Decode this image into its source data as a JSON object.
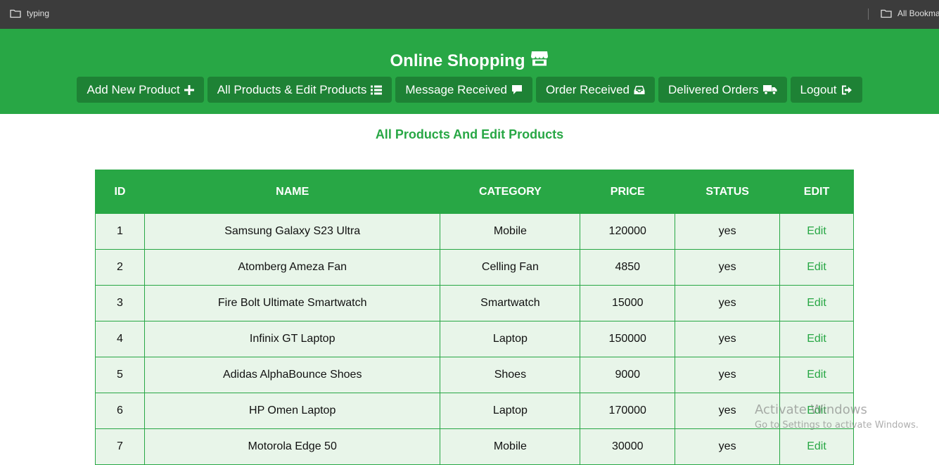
{
  "bookmarks": {
    "left_label": "typing",
    "right_label": "All Bookma"
  },
  "header": {
    "title": "Online Shopping",
    "nav": [
      {
        "label": "Add New Product",
        "icon": "plus-icon"
      },
      {
        "label": "All Products & Edit Products",
        "icon": "list-icon"
      },
      {
        "label": "Message Received",
        "icon": "comment-icon"
      },
      {
        "label": "Order Received",
        "icon": "inbox-icon"
      },
      {
        "label": "Delivered Orders",
        "icon": "truck-icon"
      },
      {
        "label": "Logout",
        "icon": "sign-out-icon"
      }
    ]
  },
  "main": {
    "section_title": "All Products And Edit Products",
    "table": {
      "headers": [
        "ID",
        "NAME",
        "CATEGORY",
        "PRICE",
        "STATUS",
        "EDIT"
      ],
      "rows": [
        {
          "id": "1",
          "name": "Samsung Galaxy S23 Ultra",
          "category": "Mobile",
          "price": "120000",
          "status": "yes",
          "edit": "Edit"
        },
        {
          "id": "2",
          "name": "Atomberg Ameza Fan",
          "category": "Celling Fan",
          "price": "4850",
          "status": "yes",
          "edit": "Edit"
        },
        {
          "id": "3",
          "name": "Fire Bolt Ultimate Smartwatch",
          "category": "Smartwatch",
          "price": "15000",
          "status": "yes",
          "edit": "Edit"
        },
        {
          "id": "4",
          "name": "Infinix GT Laptop",
          "category": "Laptop",
          "price": "150000",
          "status": "yes",
          "edit": "Edit"
        },
        {
          "id": "5",
          "name": "Adidas AlphaBounce Shoes",
          "category": "Shoes",
          "price": "9000",
          "status": "yes",
          "edit": "Edit"
        },
        {
          "id": "6",
          "name": "HP Omen Laptop",
          "category": "Laptop",
          "price": "170000",
          "status": "yes",
          "edit": "Edit"
        },
        {
          "id": "7",
          "name": "Motorola Edge 50",
          "category": "Mobile",
          "price": "30000",
          "status": "yes",
          "edit": "Edit"
        }
      ]
    }
  },
  "watermark": {
    "title": "Activate Windows",
    "subtitle": "Go to Settings to activate Windows."
  },
  "colors": {
    "brand_green": "#28a745",
    "button_green": "#1e8235",
    "row_background": "#e8f5e9"
  }
}
